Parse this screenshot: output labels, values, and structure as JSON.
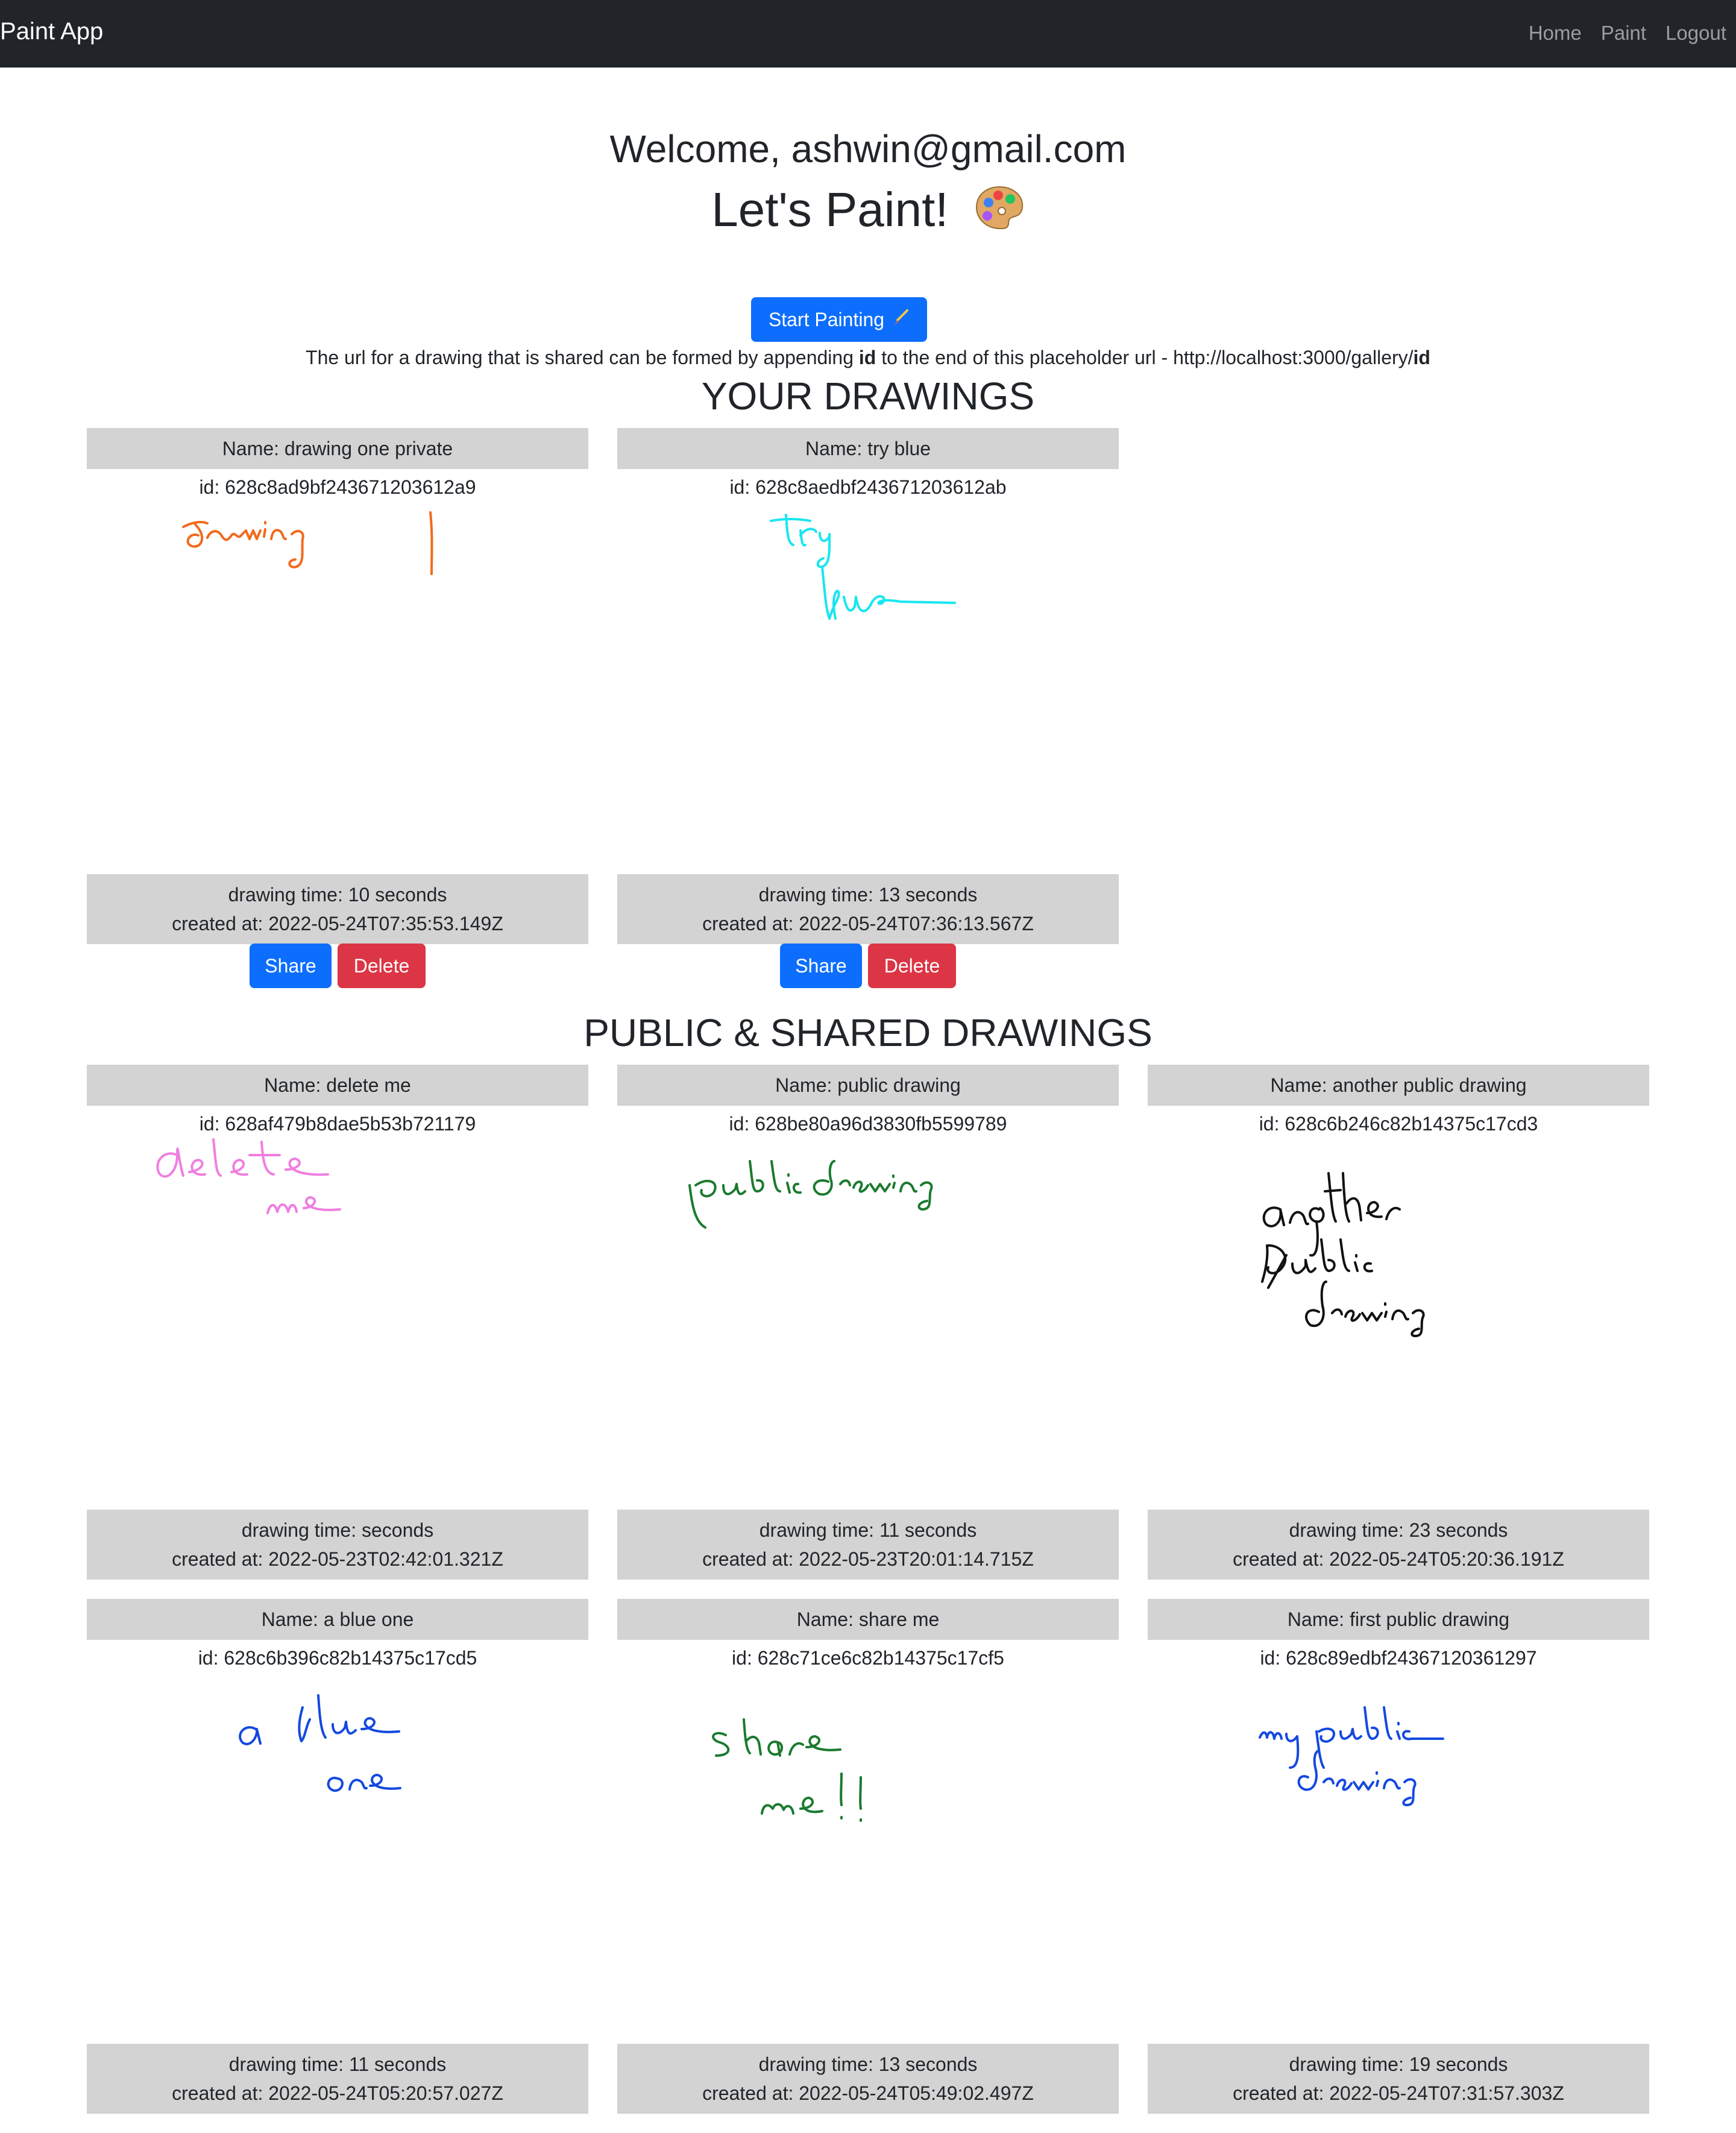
{
  "navbar": {
    "brand": "Paint App",
    "links": [
      "Home",
      "Paint",
      "Logout"
    ]
  },
  "header": {
    "welcome": "Welcome, ashwin@gmail.com",
    "title": "Let's Paint!",
    "start_button": "Start Painting",
    "url_note_prefix": "The url for a drawing that is shared can be formed by appending ",
    "url_note_bold1": "id",
    "url_note_middle": " to the end of this placeholder url - http://localhost:3000/gallery/",
    "url_note_bold2": "id"
  },
  "your_drawings": {
    "heading": "YOUR DRAWINGS",
    "share_label": "Share",
    "delete_label": "Delete",
    "items": [
      {
        "name": "Name: drawing one private",
        "id": "id: 628c8ad9bf243671203612a9",
        "time": "drawing time: 10 seconds",
        "created": "created at: 2022-05-24T07:35:53.149Z",
        "ink_color": "#f26a1b",
        "ink_text": "drawing 1"
      },
      {
        "name": "Name: try blue",
        "id": "id: 628c8aedbf243671203612ab",
        "time": "drawing time: 13 seconds",
        "created": "created at: 2022-05-24T07:36:13.567Z",
        "ink_color": "#19e6f0",
        "ink_text": "try blue"
      }
    ]
  },
  "public_drawings": {
    "heading": "PUBLIC & SHARED DRAWINGS",
    "items": [
      {
        "name": "Name: delete me",
        "id": "id: 628af479b8dae5b53b721179",
        "time": "drawing time: seconds",
        "created": "created at: 2022-05-23T02:42:01.321Z",
        "ink_color": "#f07ee0",
        "ink_text": "delete me"
      },
      {
        "name": "Name: public drawing",
        "id": "id: 628be80a96d3830fb5599789",
        "time": "drawing time: 11 seconds",
        "created": "created at: 2022-05-23T20:01:14.715Z",
        "ink_color": "#1a7a2e",
        "ink_text": "public drawing"
      },
      {
        "name": "Name: another public drawing",
        "id": "id: 628c6b246c82b14375c17cd3",
        "time": "drawing time: 23 seconds",
        "created": "created at: 2022-05-24T05:20:36.191Z",
        "ink_color": "#111111",
        "ink_text": "another public drawing"
      },
      {
        "name": "Name: a blue one",
        "id": "id: 628c6b396c82b14375c17cd5",
        "time": "drawing time: 11 seconds",
        "created": "created at: 2022-05-24T05:20:57.027Z",
        "ink_color": "#1448e0",
        "ink_text": "a blue one"
      },
      {
        "name": "Name: share me",
        "id": "id: 628c71ce6c82b14375c17cf5",
        "time": "drawing time: 13 seconds",
        "created": "created at: 2022-05-24T05:49:02.497Z",
        "ink_color": "#1a7a2e",
        "ink_text": "share me !!"
      },
      {
        "name": "Name: first public drawing",
        "id": "id: 628c89edbf24367120361297",
        "time": "drawing time: 19 seconds",
        "created": "created at: 2022-05-24T07:31:57.303Z",
        "ink_color": "#1448e0",
        "ink_text": "my public drawing"
      }
    ]
  }
}
